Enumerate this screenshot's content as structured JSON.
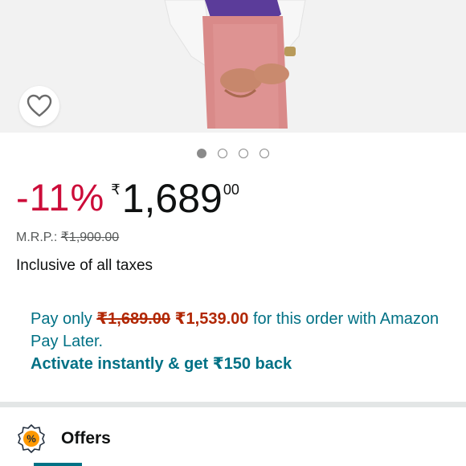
{
  "product": {
    "image_alt": "",
    "carousel": {
      "count": 4,
      "active": 0
    }
  },
  "pricing": {
    "discount": "-11%",
    "currency_symbol": "₹",
    "price_whole": "1,689",
    "price_fraction": "00",
    "mrp_label": "M.R.P.:",
    "mrp_value": "₹1,900.00",
    "taxes_note": "Inclusive of all taxes"
  },
  "pay_later": {
    "prefix": "Pay only ",
    "old_amount": "₹1,689.00",
    "new_amount": "₹1,539.00",
    "suffix": " for this order with Amazon Pay Later.",
    "cta": "Activate instantly & get ₹150 back"
  },
  "offers": {
    "label": "Offers",
    "icon": "percent-badge-icon"
  },
  "colors": {
    "discount": "#cc0c39",
    "strike_price": "#b12704",
    "link_teal": "#007185",
    "divider": "#e3e6e6"
  }
}
